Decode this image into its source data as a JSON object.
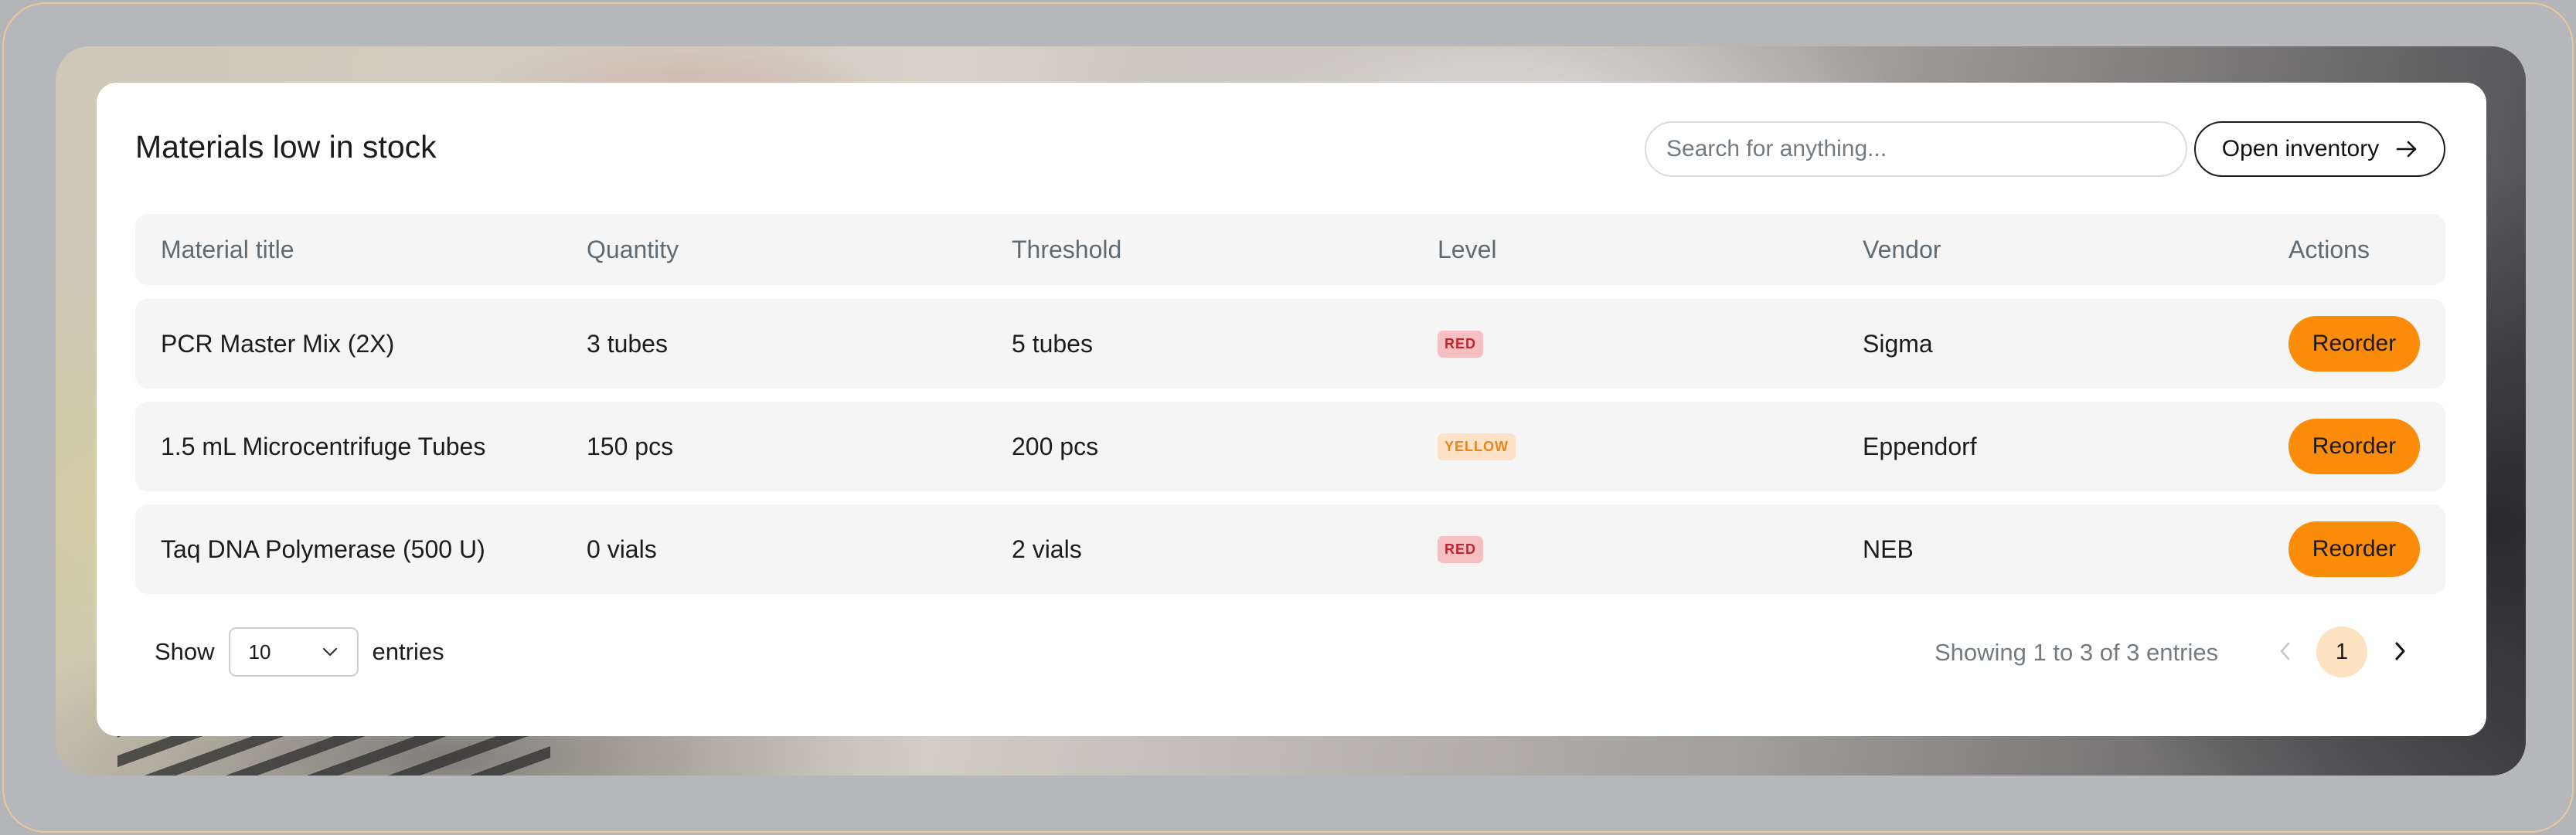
{
  "card": {
    "title": "Materials low in stock",
    "search_placeholder": "Search for anything...",
    "open_inventory_label": "Open inventory",
    "open_inventory_icon": "arrow-right-icon"
  },
  "table": {
    "columns": [
      "Material title",
      "Quantity",
      "Threshold",
      "Level",
      "Vendor",
      "Actions"
    ],
    "rows": [
      {
        "title": "PCR Master Mix (2X)",
        "quantity": "3 tubes",
        "threshold": "5 tubes",
        "level": "RED",
        "vendor": "Sigma",
        "action": "Reorder"
      },
      {
        "title": "1.5 mL Microcentrifuge Tubes",
        "quantity": "150 pcs",
        "threshold": "200 pcs",
        "level": "YELLOW",
        "vendor": "Eppendorf",
        "action": "Reorder"
      },
      {
        "title": "Taq DNA Polymerase (500 U)",
        "quantity": "0 vials",
        "threshold": "2 vials",
        "level": "RED",
        "vendor": "NEB",
        "action": "Reorder"
      }
    ]
  },
  "footer": {
    "show_label": "Show",
    "entries_value": "10",
    "entries_label": "entries",
    "showing_text": "Showing 1 to 3 of 3 entries",
    "current_page": "1"
  },
  "colors": {
    "accent": "#fb8c0a",
    "level_red_bg": "#f6c0c3",
    "level_red_text": "#c0252e",
    "level_yellow_bg": "#fde2c8",
    "level_yellow_text": "#e8851b",
    "page_active_bg": "#fde2c2"
  }
}
